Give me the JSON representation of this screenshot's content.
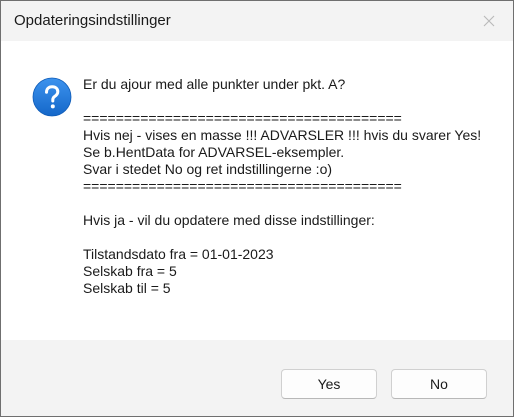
{
  "window": {
    "title": "Opdateringsindstillinger"
  },
  "message": {
    "icon": "question-icon",
    "lines": [
      "Er du ajour med alle punkter under pkt. A?",
      "",
      "=======================================",
      "Hvis nej - vises en masse !!! ADVARSLER !!! hvis du svarer Yes!",
      "Se b.HentData for ADVARSEL-eksempler.",
      "Svar i stedet No og ret indstillingerne :o)",
      "=======================================",
      "",
      "Hvis ja - vil du opdatere med disse indstillinger:",
      "",
      "Tilstandsdato fra = 01-01-2023",
      "Selskab fra = 5",
      "Selskab til = 5"
    ]
  },
  "buttons": {
    "yes_label": "Yes",
    "no_label": "No"
  },
  "colors": {
    "titlebar_bg": "#f3f3f3",
    "footer_bg": "#f3f3f3",
    "icon_blue": "#1a73d9"
  }
}
